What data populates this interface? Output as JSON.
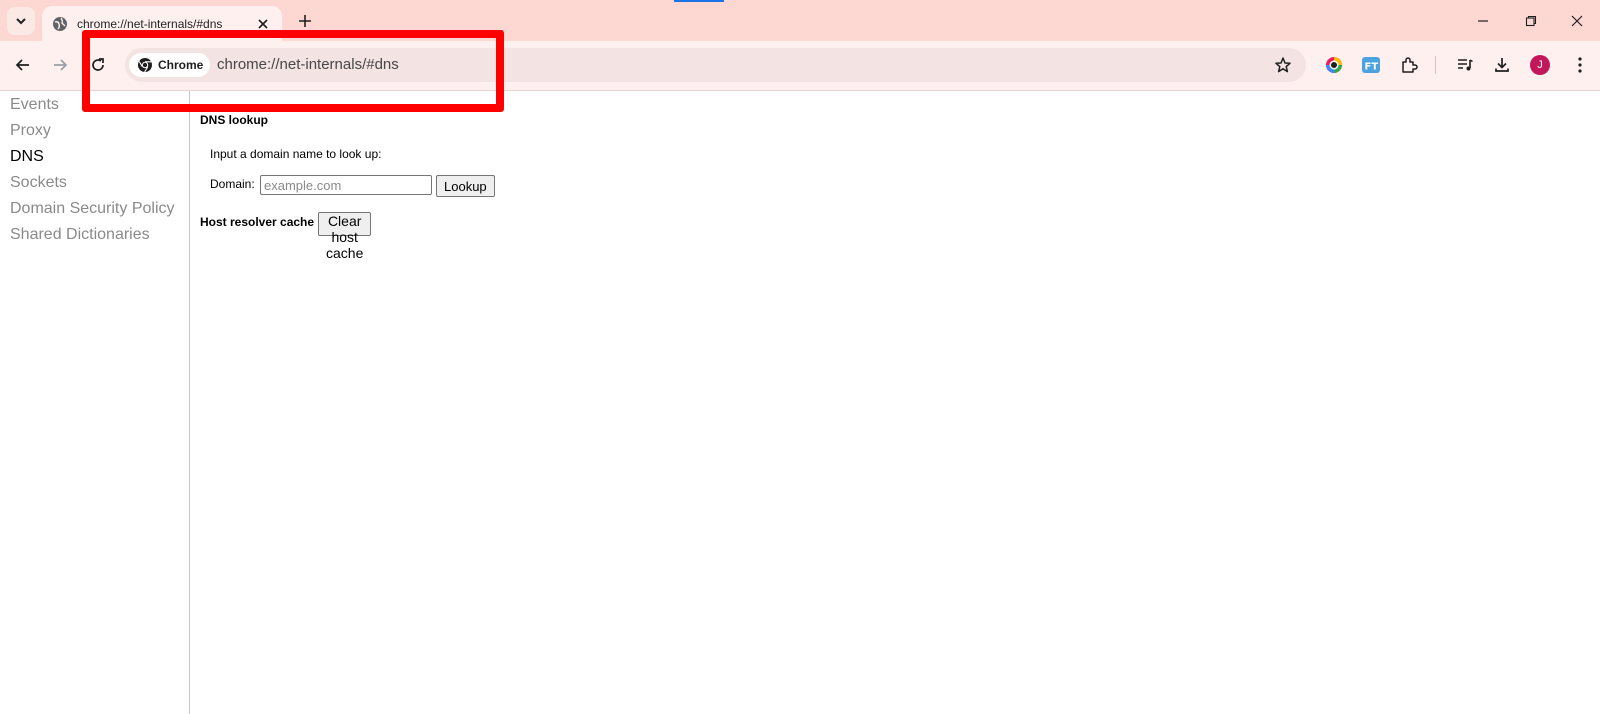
{
  "colors": {
    "tabstrip_bg": "#fdd8d2",
    "toolbar_bg": "#fdf0ef",
    "highlight": "#ff0000",
    "avatar_bg": "#c2185b"
  },
  "tab": {
    "title": "chrome://net-internals/#dns",
    "favicon": "globe-icon"
  },
  "omnibox": {
    "chip_label": "Chrome",
    "url": "chrome://net-internals/#dns"
  },
  "profile": {
    "initial": "J"
  },
  "sidebar": {
    "items": [
      {
        "label": "Events"
      },
      {
        "label": "Proxy"
      },
      {
        "label": "DNS",
        "active": true
      },
      {
        "label": "Sockets"
      },
      {
        "label": "Domain Security Policy"
      },
      {
        "label": "Shared Dictionaries"
      }
    ]
  },
  "dns": {
    "lookup_title": "DNS lookup",
    "hint": "Input a domain name to look up:",
    "domain_label": "Domain:",
    "domain_value": "",
    "domain_placeholder": "example.com",
    "lookup_button": "Lookup",
    "cache_title": "Host resolver cache",
    "clear_cache_button": "Clear host cache"
  }
}
